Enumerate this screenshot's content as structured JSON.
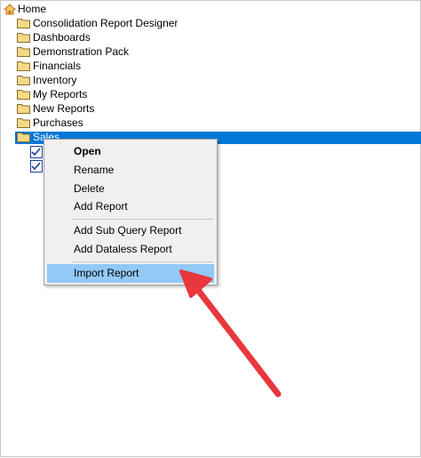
{
  "tree": {
    "root": {
      "label": "Home",
      "icon": "home-icon"
    },
    "folders": [
      {
        "label": "Consolidation Report Designer",
        "icon": "folder-icon"
      },
      {
        "label": "Dashboards",
        "icon": "folder-icon"
      },
      {
        "label": "Demonstration Pack",
        "icon": "folder-icon"
      },
      {
        "label": "Financials",
        "icon": "folder-icon"
      },
      {
        "label": "Inventory",
        "icon": "folder-icon"
      },
      {
        "label": "My Reports",
        "icon": "folder-icon"
      },
      {
        "label": "New Reports",
        "icon": "folder-icon"
      },
      {
        "label": "Purchases",
        "icon": "folder-icon"
      },
      {
        "label": "Sales",
        "icon": "folder-icon",
        "selected": true
      }
    ],
    "sales_children": [
      {
        "icon": "report-icon"
      },
      {
        "icon": "report-icon"
      }
    ]
  },
  "context_menu": {
    "items": [
      {
        "label": "Open",
        "bold": true
      },
      {
        "label": "Rename"
      },
      {
        "label": "Delete"
      },
      {
        "label": "Add Report"
      },
      {
        "label": "Add Sub Query Report"
      },
      {
        "label": "Add Dataless Report"
      },
      {
        "label": "Import Report",
        "highlighted": true
      }
    ]
  },
  "colors": {
    "selection": "#0078d7",
    "menu_highlight": "#91c9f7",
    "menu_background": "#f0f0f0",
    "annotation_arrow": "#e8383d",
    "folder_fill": "#f5d987"
  }
}
